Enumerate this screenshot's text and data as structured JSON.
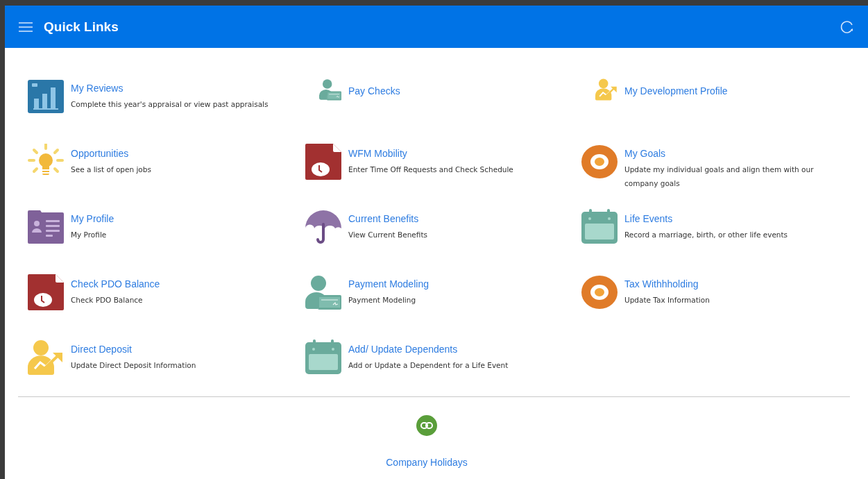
{
  "header": {
    "title": "Quick Links"
  },
  "links": [
    {
      "title": "My Reviews",
      "description": "Complete this year's appraisal or view past appraisals",
      "kind": "chart",
      "small": false
    },
    {
      "title": "Pay Checks",
      "kind": "paycheck",
      "small": true
    },
    {
      "title": "My Development Profile",
      "kind": "growth",
      "small": true
    },
    {
      "title": "Opportunities",
      "description": "See a list of open jobs",
      "kind": "idea",
      "small": false
    },
    {
      "title": "WFM Mobility",
      "description": "Enter Time Off Requests and Check Schedule",
      "kind": "timesheet",
      "small": false
    },
    {
      "title": "My Goals",
      "description": "Update my individual goals and align them with our company goals",
      "kind": "goal",
      "small": false
    },
    {
      "title": "My Profile",
      "description": "My Profile",
      "kind": "profile",
      "small": false
    },
    {
      "title": "Current Benefits",
      "description": "View Current Benefits",
      "kind": "benefit",
      "small": false
    },
    {
      "title": "Life Events",
      "description": "Record a marriage, birth, or other life events",
      "kind": "event",
      "small": false
    },
    {
      "title": "Check PDO Balance",
      "description": "Check PDO Balance",
      "kind": "timesheet",
      "small": false
    },
    {
      "title": "Payment Modeling",
      "description": "Payment Modeling",
      "kind": "paycheck",
      "small": false
    },
    {
      "title": "Tax Withhholding",
      "description": "Update Tax Information",
      "kind": "goal",
      "small": false
    },
    {
      "title": "Direct Deposit",
      "description": "Update Direct Deposit Information",
      "kind": "growth",
      "small": false
    },
    {
      "title": "Add/ Update Dependents",
      "description": "Add or Update a Dependent for a Life Event",
      "kind": "event",
      "small": false
    }
  ],
  "footer_link": {
    "title": "Company Holidays"
  }
}
